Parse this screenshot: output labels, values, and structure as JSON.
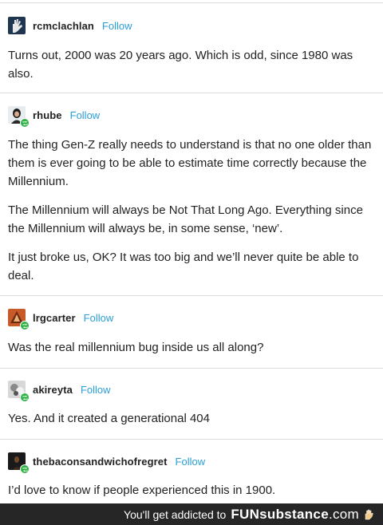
{
  "posts": [
    {
      "username": "rcmclachlan",
      "follow": "Follow",
      "reblogged": false,
      "paragraphs": [
        "Turns out, 2000 was 20 years ago. Which is odd, since 1980 was also."
      ]
    },
    {
      "username": "rhube",
      "follow": "Follow",
      "reblogged": true,
      "paragraphs": [
        "The thing Gen-Z really needs to understand is that no one older than them is ever going to be able to estimate time correctly because the Millennium.",
        "The Millennium will always be Not That Long Ago. Everything since the Millennium will always be, in some sense, ‘new’.",
        "It just broke us, OK? It was too big and we’ll never quite be able to deal."
      ]
    },
    {
      "username": "lrgcarter",
      "follow": "Follow",
      "reblogged": true,
      "paragraphs": [
        "Was the real millennium bug inside us all along?"
      ]
    },
    {
      "username": "akireyta",
      "follow": "Follow",
      "reblogged": true,
      "paragraphs": [
        "Yes. And it created a generational 404"
      ]
    },
    {
      "username": "thebaconsandwichofregret",
      "follow": "Follow",
      "reblogged": true,
      "paragraphs": [
        "I’d love to know if people experienced this in 1900."
      ]
    }
  ],
  "footer": {
    "tagline": "You'll get addicted to",
    "brand_bold": "FUN",
    "brand_rest": "substance",
    "brand_tld": ".com",
    "icon": "hand-icon"
  },
  "colors": {
    "follow": "#2a9fd8",
    "reblog_badge": "#2fb344",
    "footer_bg": "#262626"
  }
}
